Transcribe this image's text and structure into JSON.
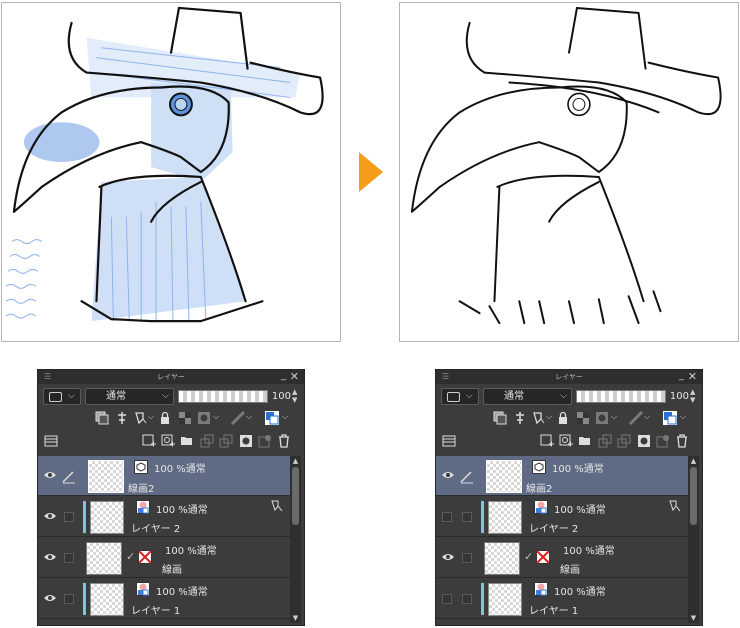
{
  "panel_title": "レイヤー",
  "blend_mode": "通常",
  "opacity": "100",
  "colors": {
    "accent_arrow": "#f59c1a",
    "selected_row": "#5f6b84",
    "clip_bar": "#76c9e3",
    "panel_bg": "#3c3c3c",
    "sketch_blue": "#7aa6e6"
  },
  "layers": [
    {
      "mode": "100 %通常",
      "name": "線画2",
      "type_icon": "vector-layer-icon",
      "selected": true
    },
    {
      "mode": "100 %通常",
      "name": "レイヤー 2",
      "type_icon": "raster-layer-icon",
      "selected": false
    },
    {
      "mode": "100 %通常",
      "name": "線画",
      "type_icon": "vector-layer-icon",
      "selected": false
    },
    {
      "mode": "100 %通常",
      "name": "レイヤー 1",
      "type_icon": "raster-layer-icon",
      "selected": false
    }
  ]
}
